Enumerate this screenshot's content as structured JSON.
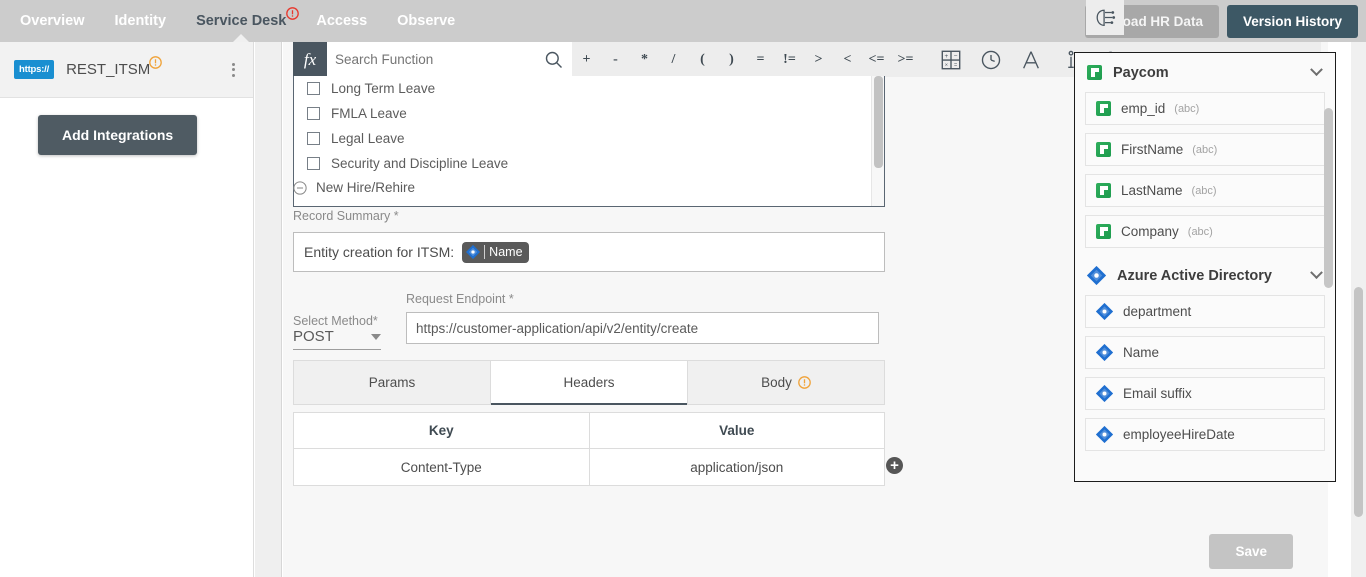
{
  "topnav": {
    "items": [
      {
        "label": "Overview",
        "active": false,
        "warn": false
      },
      {
        "label": "Identity",
        "active": false,
        "warn": false
      },
      {
        "label": "Service Desk",
        "active": true,
        "warn": true
      },
      {
        "label": "Access",
        "active": false,
        "warn": false
      },
      {
        "label": "Observe",
        "active": false,
        "warn": false
      }
    ],
    "upload_label": "Upload HR Data",
    "version_label": "Version History",
    "bg_color": "#cccccc",
    "version_color": "#3d5865"
  },
  "sidebar": {
    "integration": {
      "badge": "https://",
      "name": "REST_ITSM",
      "warn": true
    },
    "add_button_label": "Add Integrations"
  },
  "formula_bar": {
    "fx_label": "fx",
    "search_placeholder": "Search Function",
    "search_value": "",
    "operators": [
      "+",
      "-",
      "*",
      "/",
      "(",
      ")",
      "=",
      "!=",
      ">",
      "<",
      "<=",
      ">="
    ],
    "tools": [
      "calculator-icon",
      "clock-icon",
      "text-format-icon",
      "info-icon",
      "ai-brain-icon"
    ]
  },
  "checkbox_list": {
    "items": [
      {
        "label": "Long Term Leave",
        "checked": false
      },
      {
        "label": "FMLA Leave",
        "checked": false
      },
      {
        "label": "Legal Leave",
        "checked": false
      },
      {
        "label": "Security and Discipline Leave",
        "checked": false
      }
    ]
  },
  "section": {
    "title": "New Hire/Rehire",
    "record_summary_label": "Record Summary *",
    "record_summary_text": "Entity creation for ITSM:",
    "record_summary_token": "Name"
  },
  "request": {
    "method_label": "Select Method*",
    "method_value": "POST",
    "endpoint_label": "Request Endpoint *",
    "endpoint_value": "https://customer-application/api/v2/entity/create"
  },
  "tabs": [
    {
      "label": "Params",
      "active": false,
      "warn": false
    },
    {
      "label": "Headers",
      "active": true,
      "warn": false
    },
    {
      "label": "Body",
      "active": false,
      "warn": true
    }
  ],
  "kv_table": {
    "headers": [
      "Key",
      "Value"
    ],
    "rows": [
      [
        "Content-Type",
        "application/json"
      ]
    ],
    "add_label": "+"
  },
  "save_label": "Save",
  "data_panel": {
    "groups": [
      {
        "name": "Paycom",
        "icon": "paycom-icon",
        "fields": [
          {
            "name": "emp_id",
            "type": "(abc)"
          },
          {
            "name": "FirstName",
            "type": "(abc)"
          },
          {
            "name": "LastName",
            "type": "(abc)"
          },
          {
            "name": "Company",
            "type": "(abc)"
          }
        ]
      },
      {
        "name": "Azure Active Directory",
        "icon": "azure-ad-icon",
        "fields": [
          {
            "name": "department",
            "type": ""
          },
          {
            "name": "Name",
            "type": ""
          },
          {
            "name": "Email suffix",
            "type": ""
          },
          {
            "name": "employeeHireDate",
            "type": ""
          }
        ]
      }
    ]
  }
}
